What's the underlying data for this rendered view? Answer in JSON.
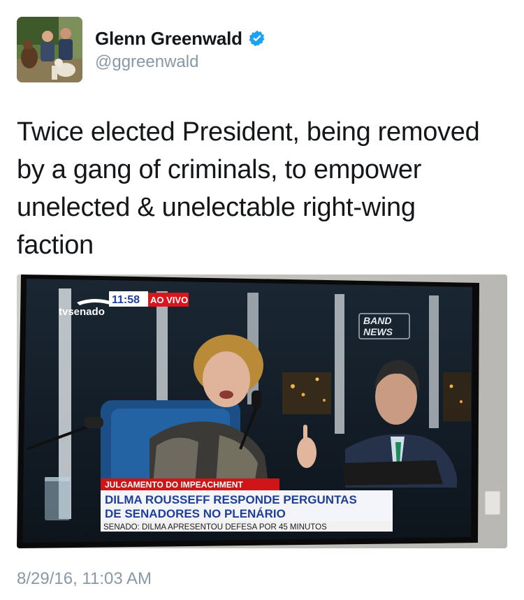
{
  "tweet": {
    "author": {
      "display_name": "Glenn Greenwald",
      "handle": "@ggreenwald",
      "verified": true,
      "avatar_icon": "profile-photo"
    },
    "text_lines": [
      "Twice elected President, being removed",
      "by a gang of criminals, to empower",
      "unelected & unelectable right-wing",
      "faction"
    ],
    "timestamp": "8/29/16, 11:03 AM",
    "colors": {
      "verified_badge": "#1da1f2",
      "secondary_text": "#8899a6",
      "primary_text": "#14171a"
    }
  },
  "media": {
    "tv_logo": "tvsenado",
    "clock": "11:58",
    "live_tag": "AO VIVO",
    "channel_bug": [
      "BAND",
      "NEWS"
    ],
    "chyron": {
      "kicker": "JULGAMENTO DO IMPEACHMENT",
      "headline_line1": "DILMA ROUSSEFF RESPONDE PERGUNTAS",
      "headline_line2": "DE SENADORES NO PLENÁRIO",
      "ticker": "SENADO: DILMA APRESENTOU DEFESA POR 45 MINUTOS"
    },
    "colors": {
      "live_red": "#d8161c",
      "chyron_red": "#d01418",
      "chyron_blue": "#1e3f98"
    }
  }
}
